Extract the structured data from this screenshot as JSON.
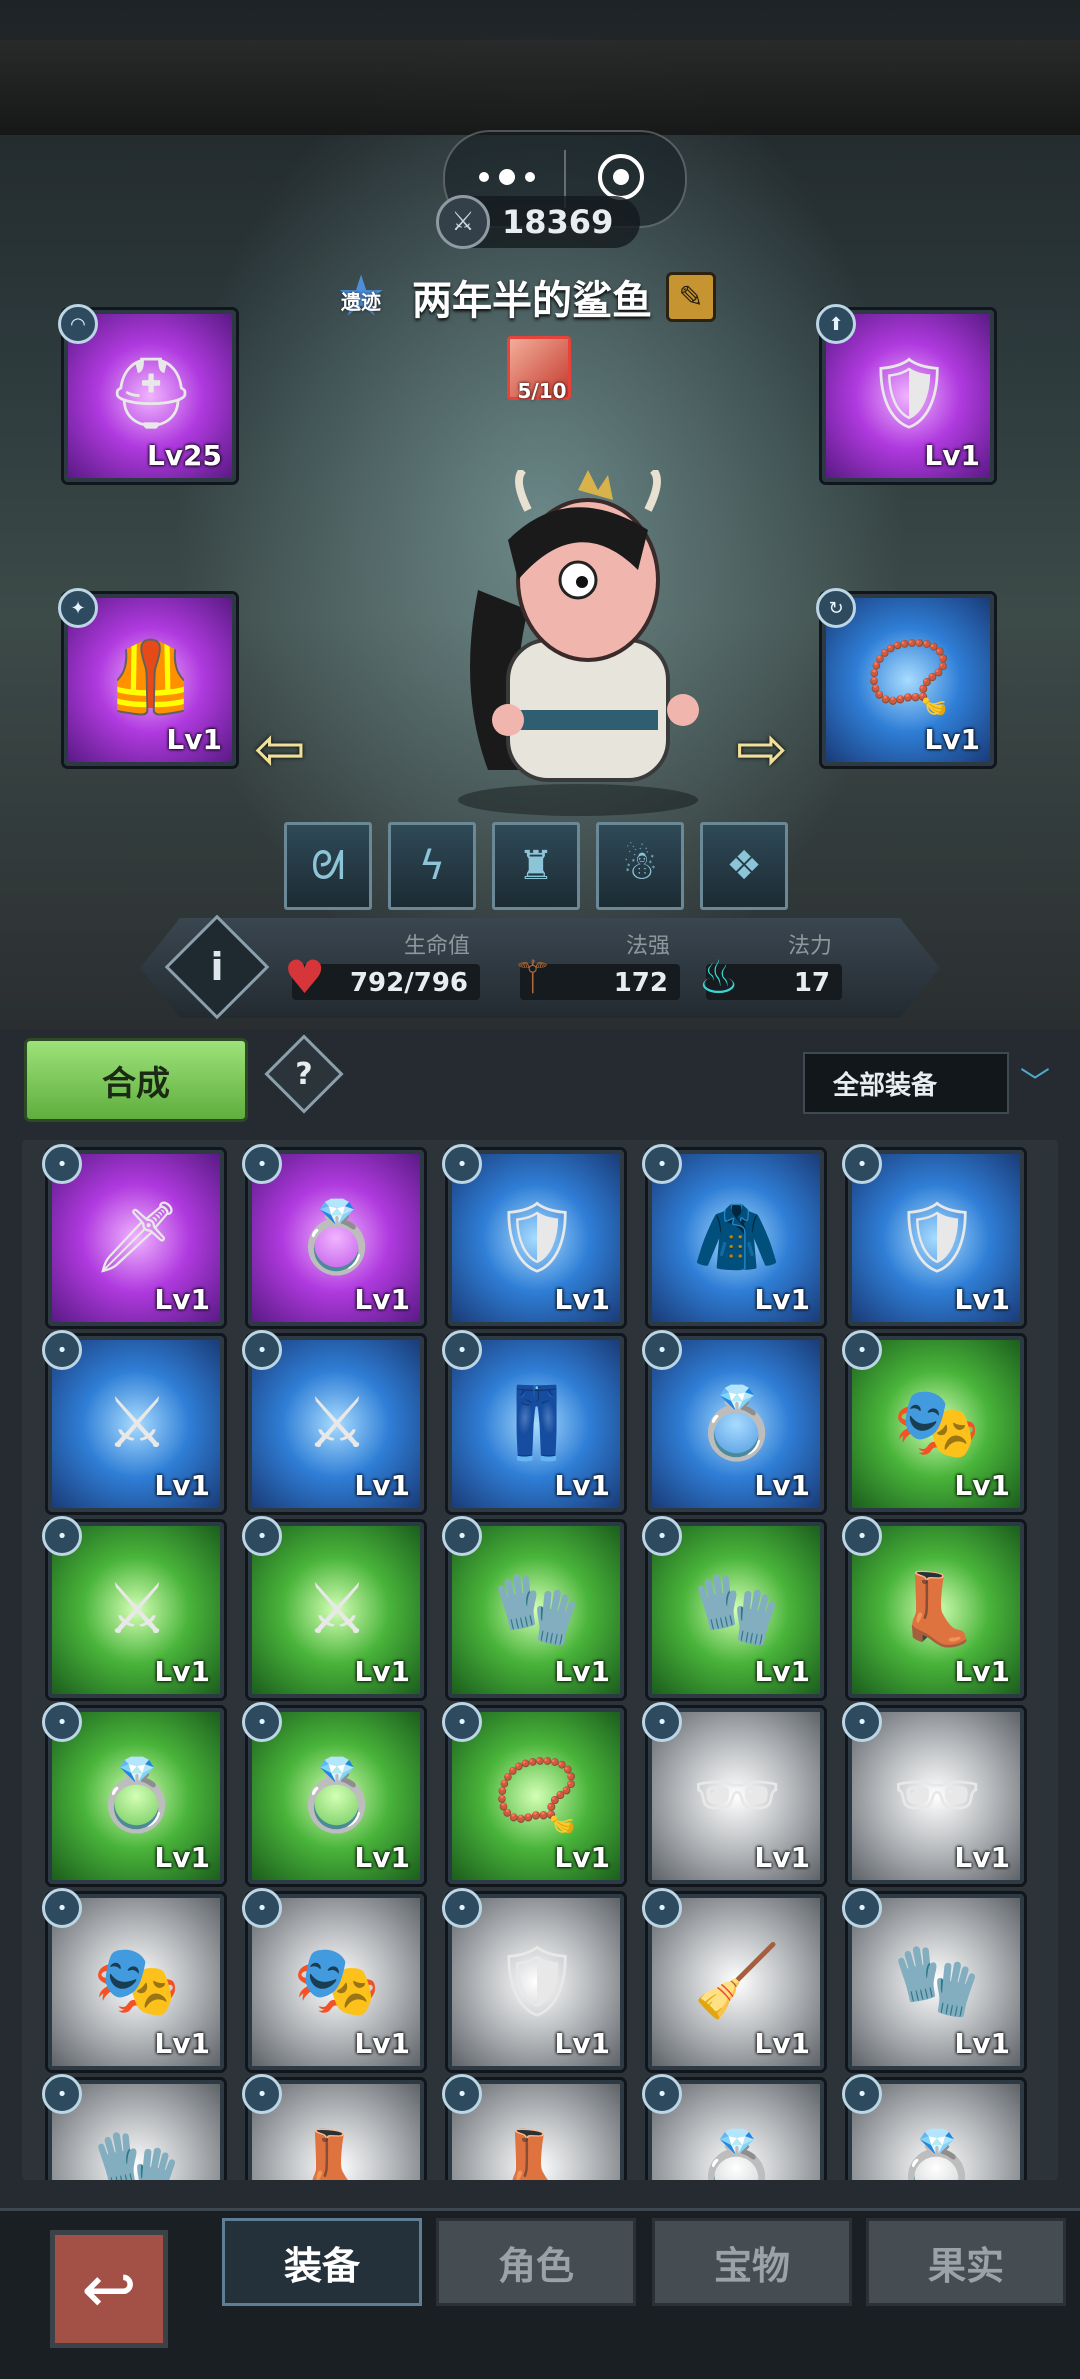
{
  "hero": {
    "power": "18369",
    "rank_tag": "遗迹",
    "name": "两年半的鲨鱼",
    "skill_progress": "5/10"
  },
  "equipped": [
    {
      "slot": "helmet",
      "lv": "Lv25",
      "rarity": "purple",
      "icon": "helmet-icon"
    },
    {
      "slot": "weapon-accessory",
      "lv": "Lv1",
      "rarity": "purple",
      "icon": "shield-icon"
    },
    {
      "slot": "armor",
      "lv": "Lv1",
      "rarity": "purple",
      "icon": "armor-icon"
    },
    {
      "slot": "necklace",
      "lv": "Lv1",
      "rarity": "blue",
      "icon": "necklace-icon"
    }
  ],
  "stats": {
    "hp_label": "生命值",
    "hp_value": "792/796",
    "atk_label": "法强",
    "atk_value": "172",
    "mana_label": "法力",
    "mana_value": "17"
  },
  "toolbar": {
    "combine_label": "合成",
    "help_label": "?",
    "filter_label": "全部装备"
  },
  "inventory": [
    {
      "lv": "Lv1",
      "rarity": "purple",
      "icon": "dagger-icon"
    },
    {
      "lv": "Lv1",
      "rarity": "purple",
      "icon": "ring-icon"
    },
    {
      "lv": "Lv1",
      "rarity": "blue",
      "icon": "shield-icon"
    },
    {
      "lv": "Lv1",
      "rarity": "blue",
      "icon": "coat-icon"
    },
    {
      "lv": "Lv1",
      "rarity": "blue",
      "icon": "shield-icon"
    },
    {
      "lv": "Lv1",
      "rarity": "blue",
      "icon": "sword-icon"
    },
    {
      "lv": "Lv1",
      "rarity": "blue",
      "icon": "sword-icon"
    },
    {
      "lv": "Lv1",
      "rarity": "blue",
      "icon": "pants-icon"
    },
    {
      "lv": "Lv1",
      "rarity": "blue",
      "icon": "ring-icon"
    },
    {
      "lv": "Lv1",
      "rarity": "green",
      "icon": "mask-icon"
    },
    {
      "lv": "Lv1",
      "rarity": "green",
      "icon": "sword-icon"
    },
    {
      "lv": "Lv1",
      "rarity": "green",
      "icon": "sword-icon"
    },
    {
      "lv": "Lv1",
      "rarity": "green",
      "icon": "glove-icon"
    },
    {
      "lv": "Lv1",
      "rarity": "green",
      "icon": "glove-icon"
    },
    {
      "lv": "Lv1",
      "rarity": "green",
      "icon": "boots-icon"
    },
    {
      "lv": "Lv1",
      "rarity": "green",
      "icon": "ring-icon"
    },
    {
      "lv": "Lv1",
      "rarity": "green",
      "icon": "ring-icon"
    },
    {
      "lv": "Lv1",
      "rarity": "green",
      "icon": "necklace-icon"
    },
    {
      "lv": "Lv1",
      "rarity": "gray",
      "icon": "glasses-icon"
    },
    {
      "lv": "Lv1",
      "rarity": "gray",
      "icon": "glasses-icon"
    },
    {
      "lv": "Lv1",
      "rarity": "gray",
      "icon": "mask-icon"
    },
    {
      "lv": "Lv1",
      "rarity": "gray",
      "icon": "mask-icon"
    },
    {
      "lv": "Lv1",
      "rarity": "gray",
      "icon": "shield-icon"
    },
    {
      "lv": "Lv1",
      "rarity": "gray",
      "icon": "broom-icon"
    },
    {
      "lv": "Lv1",
      "rarity": "gray",
      "icon": "glove-icon"
    },
    {
      "lv": "",
      "rarity": "gray",
      "icon": "glove-icon"
    },
    {
      "lv": "",
      "rarity": "gray",
      "icon": "boots-icon"
    },
    {
      "lv": "",
      "rarity": "gray",
      "icon": "boots-icon"
    },
    {
      "lv": "",
      "rarity": "gray",
      "icon": "ring-icon"
    },
    {
      "lv": "",
      "rarity": "gray",
      "icon": "ring-icon"
    }
  ],
  "tabs": [
    {
      "label": "装备",
      "active": true
    },
    {
      "label": "角色",
      "active": false
    },
    {
      "label": "宝物",
      "active": false
    },
    {
      "label": "果实",
      "active": false
    }
  ]
}
